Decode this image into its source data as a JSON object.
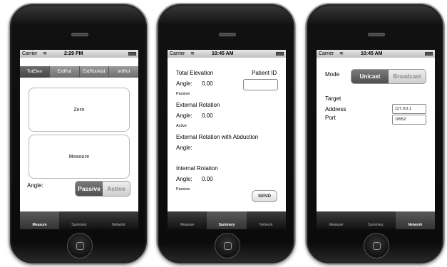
{
  "status_bar": {
    "carrier": "Carrier",
    "wifi_icon": "wifi-icon",
    "battery_icon": "battery-icon"
  },
  "phones": [
    {
      "time": "2:29 PM"
    },
    {
      "time": "10:45 AM"
    },
    {
      "time": "10:45 AM"
    }
  ],
  "measure_screen": {
    "top_segments": [
      "TotElev",
      "ExtRot",
      "ExtRotAbd",
      "IntRot"
    ],
    "zero_label": "Zero",
    "measure_label": "Measure",
    "angle_label": "Angle:",
    "passive_label": "Passive",
    "active_label": "Active"
  },
  "summary_screen": {
    "total_elevation": "Total Elevation",
    "patient_id": "Patient ID",
    "angle_label": "Angle:",
    "te_value": "0.00",
    "te_mode": "Passive",
    "external_rotation": "External Rotation",
    "er_value": "0.00",
    "er_mode": "Active",
    "er_abduction": "External Rotation with Abduction",
    "internal_rotation": "Internal Rotation",
    "ir_value": "0.00",
    "ir_mode": "Passive",
    "send_label": "SEND"
  },
  "network_screen": {
    "mode_label": "Mode",
    "unicast_label": "Unicast",
    "broadcast_label": "Broadcast",
    "target_label": "Target",
    "address_label": "Address",
    "address_value": "127.0.0.1",
    "port_label": "Port",
    "port_value": "10552"
  },
  "tabs": [
    "Measure",
    "Summary",
    "Network"
  ]
}
